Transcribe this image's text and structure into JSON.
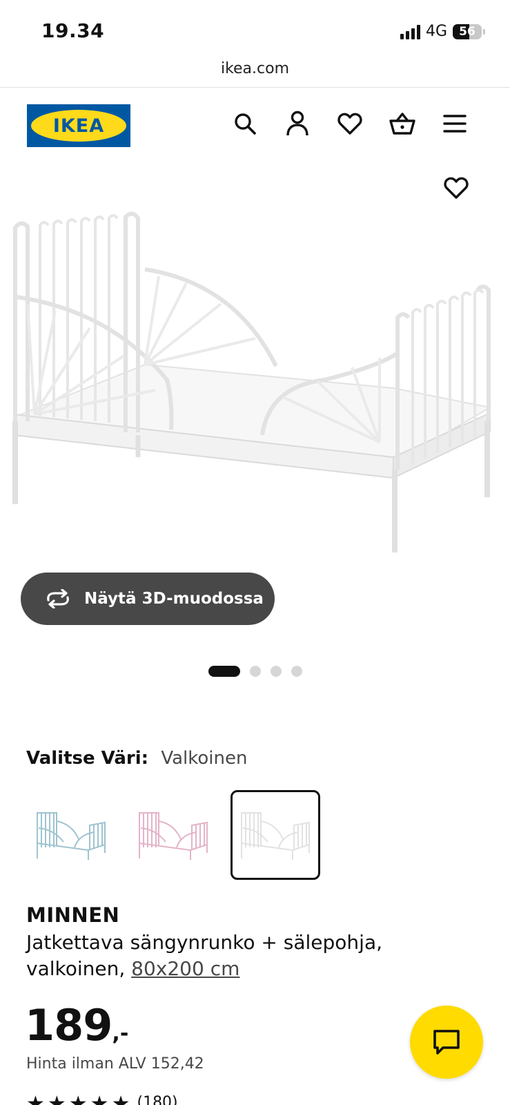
{
  "status_bar": {
    "time": "19.34",
    "network": "4G",
    "battery": "56",
    "battery_level": 0.56
  },
  "browser": {
    "url": "ikea.com"
  },
  "header": {
    "logo_text": "IKEA",
    "icons": [
      "search-icon",
      "account-icon",
      "favorites-icon",
      "cart-icon",
      "menu-icon"
    ]
  },
  "gallery": {
    "view_3d_label": "Näytä 3D-muodossa",
    "slide_count": 4,
    "active_slide": 1
  },
  "color": {
    "label": "Valitse Väri:",
    "selected": "Valkoinen",
    "variants": [
      {
        "color": "#9ec3cf",
        "selected": false
      },
      {
        "color": "#e3b3c8",
        "selected": false
      },
      {
        "color": "#e6e6e6",
        "selected": true
      }
    ]
  },
  "product": {
    "name": "MINNEN",
    "description": "Jatkettava sängynrunko + sälepohja, valkoinen,",
    "size": "80x200 cm",
    "price": "189",
    "price_suffix": ",-",
    "price_ex_vat": "Hinta ilman ALV 152,42",
    "rating_count": "(180)"
  },
  "colors": {
    "brand_blue": "#0058a3",
    "brand_yellow": "#ffda1a",
    "button_dark": "#484848"
  }
}
